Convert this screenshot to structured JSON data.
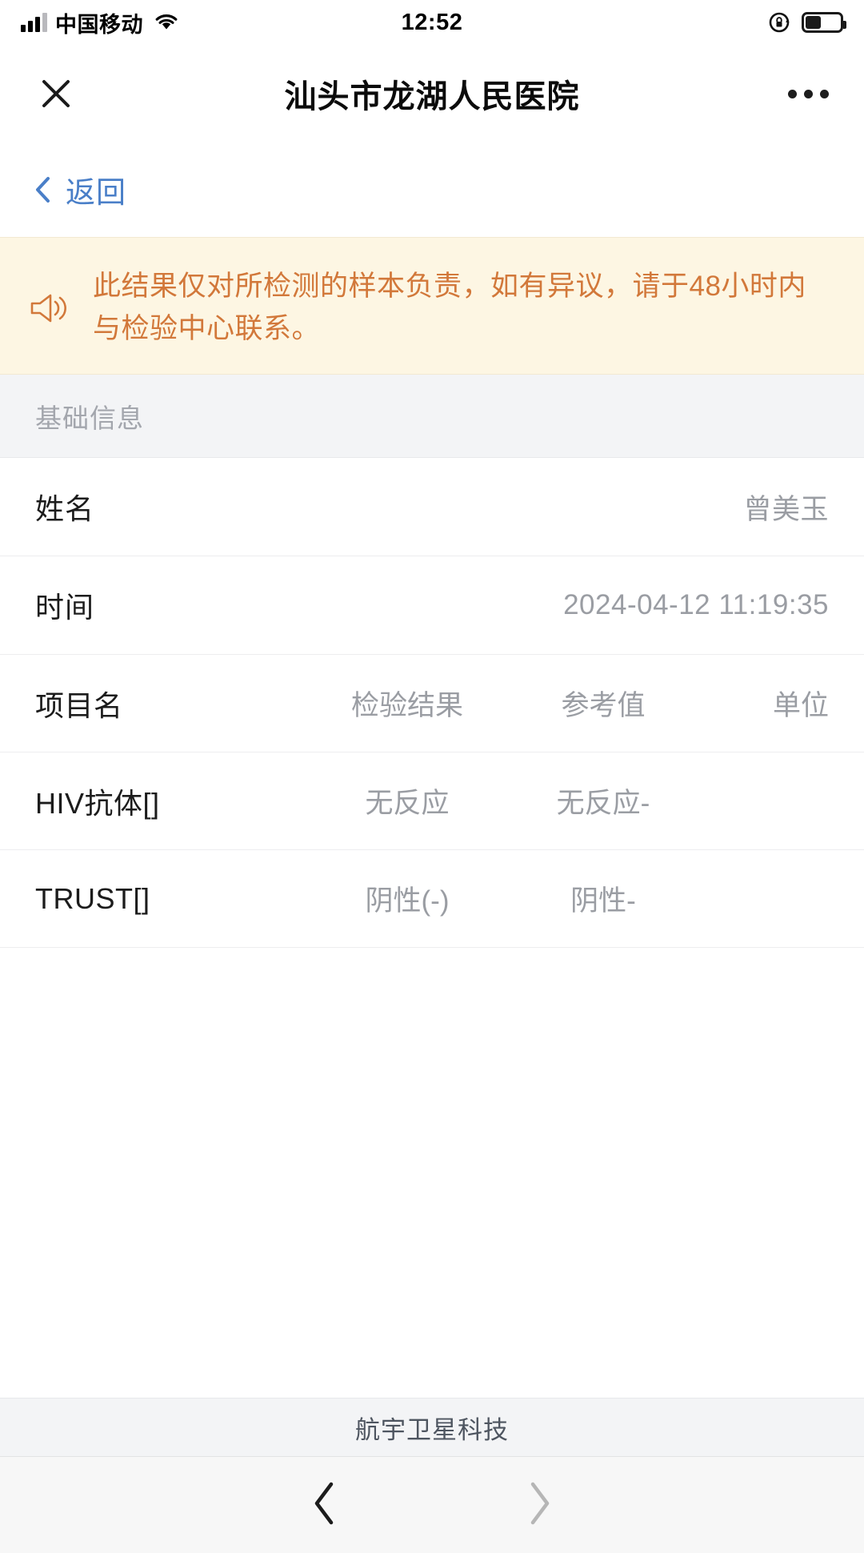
{
  "status_bar": {
    "carrier": "中国移动",
    "time": "12:52",
    "signal_icon": "signal-bars-icon",
    "wifi_icon": "wifi-icon",
    "rotation_lock_icon": "rotation-lock-icon",
    "battery_icon": "battery-icon",
    "battery_level_percent": 45
  },
  "navbar": {
    "title": "汕头市龙湖人民医院",
    "close_icon": "close-icon",
    "more_icon": "more-options-icon"
  },
  "back": {
    "label": "返回",
    "chevron_icon": "chevron-left-icon",
    "color": "#4a7fc8"
  },
  "notice": {
    "icon": "speaker-announcement-icon",
    "text": "此结果仅对所检测的样本负责，如有异议，请于48小时内与检验中心联系。",
    "text_color": "#d2783a",
    "background_color": "#fdf6e3"
  },
  "section": {
    "title": "基础信息"
  },
  "info": [
    {
      "label": "姓名",
      "value": "曾美玉"
    },
    {
      "label": "时间",
      "value": "2024-04-12 11:19:35"
    }
  ],
  "results_table": {
    "headers": [
      "项目名",
      "检验结果",
      "参考值",
      "单位"
    ],
    "rows": [
      {
        "name": "HIV抗体[]",
        "result": "无反应",
        "reference": "无反应-",
        "unit": ""
      },
      {
        "name": "TRUST[]",
        "result": "阴性(-)",
        "reference": "阴性-",
        "unit": ""
      }
    ]
  },
  "footer": {
    "brand": "航宇卫星科技"
  },
  "bottom_nav": {
    "back_icon": "chevron-left-icon",
    "forward_icon": "chevron-right-icon",
    "back_enabled_color": "#1c1c1c",
    "forward_disabled_color": "#b6b6b6"
  }
}
